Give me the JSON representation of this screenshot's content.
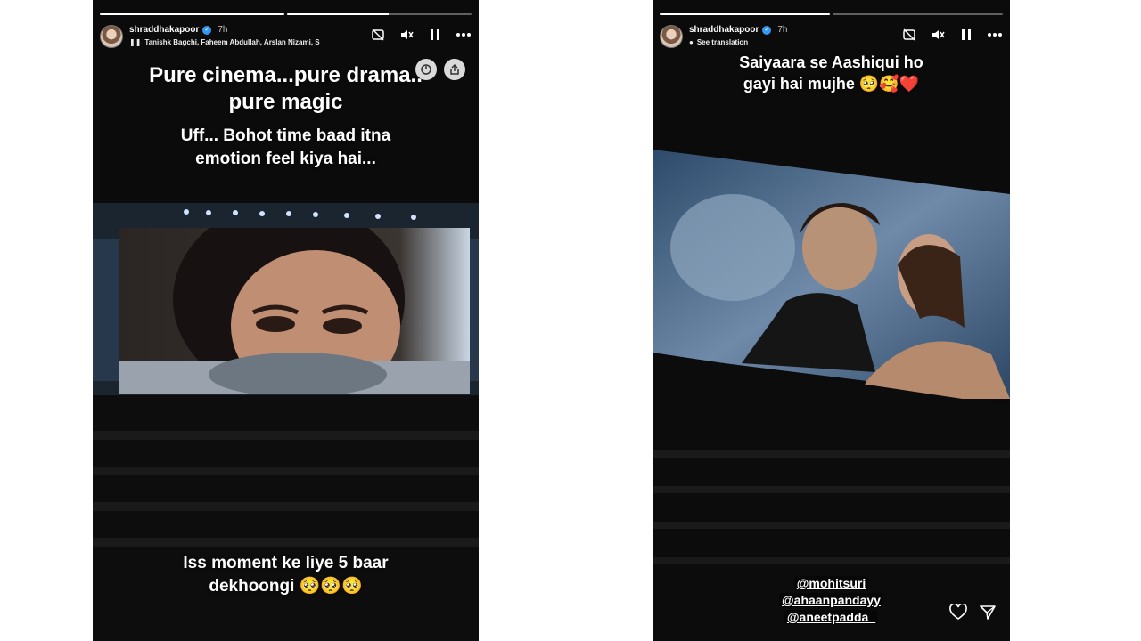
{
  "left_story": {
    "progress": [
      1.0,
      0.55,
      0
    ],
    "username": "shraddhakapoor",
    "time": "7h",
    "audio_credits": "Tanishk Bagchi, Faheem Abdullah, Arslan Nizami, S",
    "caption_top_line1": "Pure cinema...pure drama..",
    "caption_top_line2": "pure magic",
    "caption_mid_line1": "Uff... Bohot time baad itna",
    "caption_mid_line2": "emotion feel kiya hai...",
    "caption_bottom_line1": "Iss moment ke liye 5 baar",
    "caption_bottom_line2": "dekhoongi 🥺🥺🥺",
    "icons": {
      "mute_cam": "camera-off-icon",
      "sound": "speaker-muted-icon",
      "pause": "pause-icon",
      "more": "more-icon",
      "sticker": "sticker-icon",
      "share": "share-icon"
    }
  },
  "right_story": {
    "progress": [
      1.0,
      0.0
    ],
    "username": "shraddhakapoor",
    "time": "7h",
    "see_translation": "See translation",
    "caption_line1": "Saiyaara se Aashiqui ho",
    "caption_line2": "gayi hai mujhe 🥺🥰❤️",
    "mentions": [
      "@mohitsuri",
      "@ahaanpandayy",
      "@aneetpadda_"
    ],
    "icons": {
      "like": "heart-icon",
      "send": "send-icon"
    }
  },
  "colors": {
    "story_bg": "#0b0b0b",
    "verified": "#3797f0",
    "page_bg": "#ffffff"
  }
}
